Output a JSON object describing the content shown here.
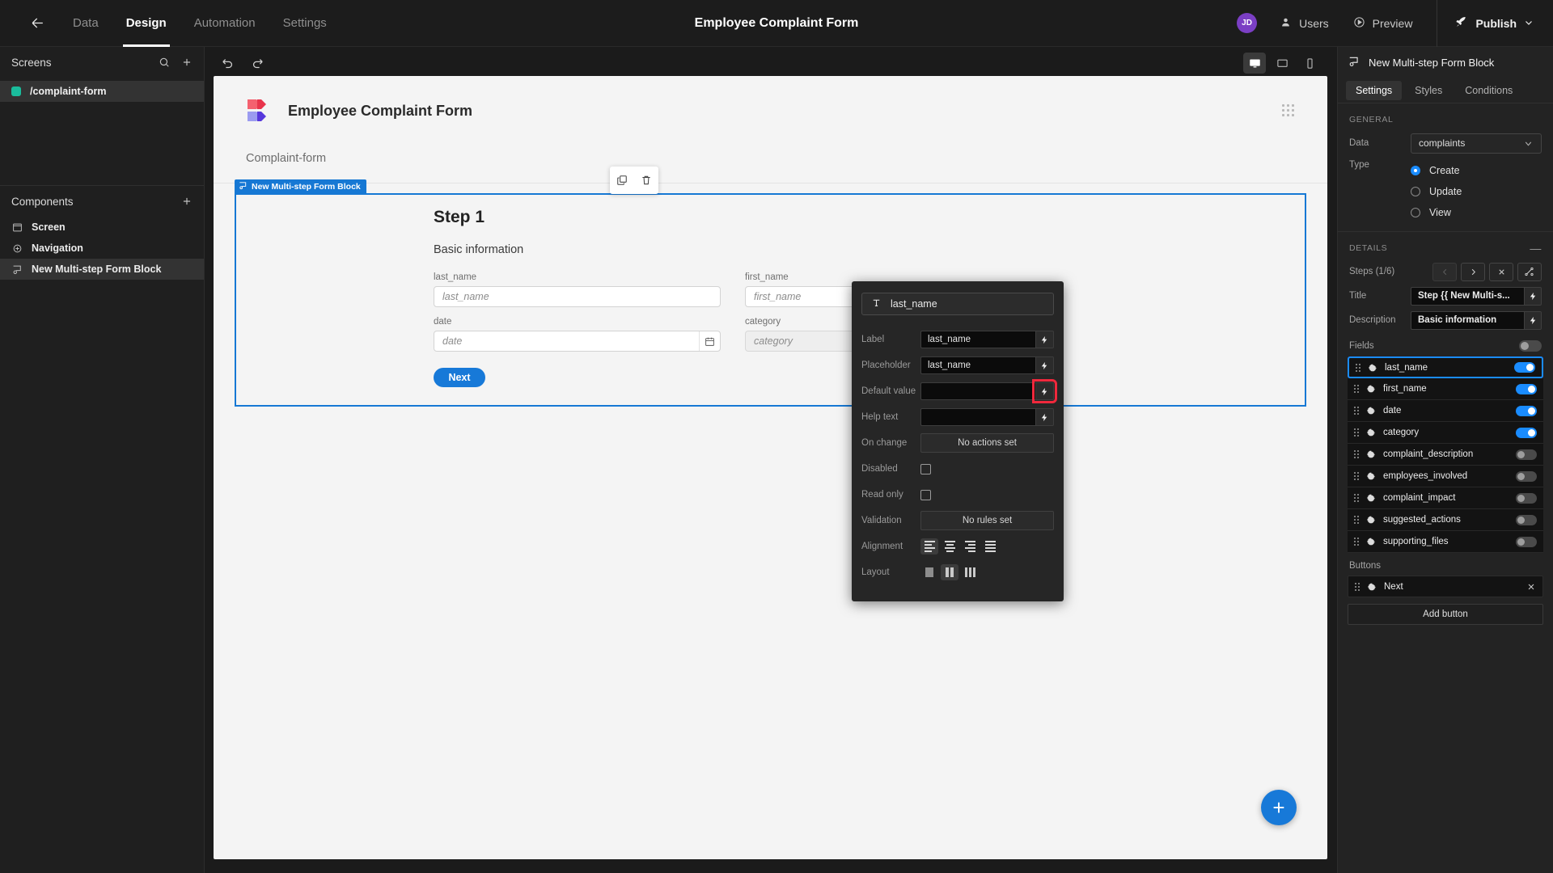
{
  "topbar": {
    "back_icon": "arrow-left-icon",
    "nav": [
      {
        "label": "Data",
        "active": false
      },
      {
        "label": "Design",
        "active": true
      },
      {
        "label": "Automation",
        "active": false
      },
      {
        "label": "Settings",
        "active": false
      }
    ],
    "title": "Employee Complaint Form",
    "avatar_initials": "JD",
    "avatar_color": "#7b3fc4",
    "users_label": "Users",
    "preview_label": "Preview",
    "publish_label": "Publish"
  },
  "sidebar": {
    "screens_header": "Screens",
    "screens": [
      {
        "label": "/complaint-form",
        "dot_color": "#1abc9c",
        "selected": true
      }
    ],
    "components_header": "Components",
    "components": [
      {
        "label": "Screen",
        "icon": "screen-icon",
        "selected": false
      },
      {
        "label": "Navigation",
        "icon": "navigation-icon",
        "selected": false
      },
      {
        "label": "New Multi-step Form Block",
        "icon": "form-block-icon",
        "selected": true
      }
    ]
  },
  "canvas": {
    "undo_icon": "undo-icon",
    "redo_icon": "redo-icon",
    "devices": [
      {
        "name": "desktop-icon",
        "active": true
      },
      {
        "name": "tablet-icon",
        "active": false
      },
      {
        "name": "mobile-icon",
        "active": false
      }
    ],
    "page_title": "Employee Complaint Form",
    "breadcrumb": "Complaint-form",
    "block_tag": "New Multi-step Form Block",
    "step_title": "Step 1",
    "step_description": "Basic information",
    "fields": [
      {
        "label": "last_name",
        "placeholder": "last_name",
        "type": "text"
      },
      {
        "label": "first_name",
        "placeholder": "first_name",
        "type": "text"
      },
      {
        "label": "date",
        "placeholder": "date",
        "type": "date"
      },
      {
        "label": "category",
        "placeholder": "category",
        "type": "select"
      }
    ],
    "next_label": "Next",
    "fab_label": "+",
    "accent_color": "#1779d8"
  },
  "field_panel": {
    "title": "last_name",
    "rows": {
      "label": "Label",
      "label_value": "last_name",
      "placeholder": "Placeholder",
      "placeholder_value": "last_name",
      "default_value": "Default value",
      "default_value_value": "",
      "help_text": "Help text",
      "help_text_value": "",
      "on_change": "On change",
      "on_change_value": "No actions set",
      "disabled": "Disabled",
      "read_only": "Read only",
      "validation": "Validation",
      "validation_value": "No rules set",
      "alignment": "Alignment",
      "layout": "Layout"
    },
    "highlight_color": "#f0283c"
  },
  "right_panel": {
    "title": "New Multi-step Form Block",
    "tabs": [
      {
        "label": "Settings",
        "active": true
      },
      {
        "label": "Styles",
        "active": false
      },
      {
        "label": "Conditions",
        "active": false
      }
    ],
    "general_header": "GENERAL",
    "data_label": "Data",
    "data_value": "complaints",
    "type_label": "Type",
    "type_options": [
      {
        "label": "Create",
        "selected": true
      },
      {
        "label": "Update",
        "selected": false
      },
      {
        "label": "View",
        "selected": false
      }
    ],
    "details_header": "DETAILS",
    "steps_label": "Steps (1/6)",
    "title_label": "Title",
    "title_value": "Step {{ New Multi-s...",
    "description_label": "Description",
    "description_value": "Basic information",
    "fields_label": "Fields",
    "fields_master_on": false,
    "fields": [
      {
        "name": "last_name",
        "enabled": true,
        "selected": true
      },
      {
        "name": "first_name",
        "enabled": true,
        "selected": false
      },
      {
        "name": "date",
        "enabled": true,
        "selected": false
      },
      {
        "name": "category",
        "enabled": true,
        "selected": false
      },
      {
        "name": "complaint_description",
        "enabled": false,
        "selected": false
      },
      {
        "name": "employees_involved",
        "enabled": false,
        "selected": false
      },
      {
        "name": "complaint_impact",
        "enabled": false,
        "selected": false
      },
      {
        "name": "suggested_actions",
        "enabled": false,
        "selected": false
      },
      {
        "name": "supporting_files",
        "enabled": false,
        "selected": false
      }
    ],
    "buttons_label": "Buttons",
    "buttons": [
      {
        "name": "Next"
      }
    ],
    "add_button_label": "Add button",
    "accent_color": "#1a8cff"
  }
}
